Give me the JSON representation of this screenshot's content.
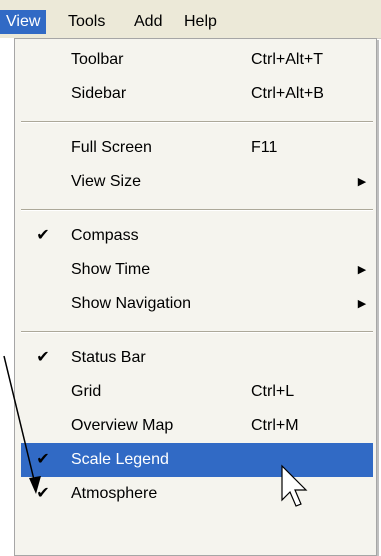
{
  "menubar": {
    "items": [
      "View",
      "Tools",
      "Add",
      "Help"
    ],
    "active": "View"
  },
  "menu": {
    "items": [
      {
        "label": "Toolbar",
        "shortcut": "Ctrl+Alt+T",
        "checked": false,
        "submenu": false
      },
      {
        "label": "Sidebar",
        "shortcut": "Ctrl+Alt+B",
        "checked": false,
        "submenu": false
      },
      {
        "label": "Full Screen",
        "shortcut": "F11",
        "checked": false,
        "submenu": false
      },
      {
        "label": "View Size",
        "shortcut": "",
        "checked": false,
        "submenu": true
      },
      {
        "label": "Compass",
        "shortcut": "",
        "checked": true,
        "submenu": false
      },
      {
        "label": "Show Time",
        "shortcut": "",
        "checked": false,
        "submenu": true
      },
      {
        "label": "Show Navigation",
        "shortcut": "",
        "checked": false,
        "submenu": true
      },
      {
        "label": "Status Bar",
        "shortcut": "",
        "checked": true,
        "submenu": false
      },
      {
        "label": "Grid",
        "shortcut": "Ctrl+L",
        "checked": false,
        "submenu": false
      },
      {
        "label": "Overview Map",
        "shortcut": "Ctrl+M",
        "checked": false,
        "submenu": false
      },
      {
        "label": "Scale Legend",
        "shortcut": "",
        "checked": true,
        "submenu": false,
        "highlighted": true
      },
      {
        "label": "Atmosphere",
        "shortcut": "",
        "checked": true,
        "submenu": false
      }
    ]
  },
  "colors": {
    "highlight": "#316ac5",
    "menubar_bg": "#ece9d8",
    "menu_bg": "#f5f4ee"
  },
  "icons": {
    "check": "checkmark-icon",
    "submenu": "submenu-arrow-icon",
    "cursor": "mouse-cursor-icon",
    "annotation": "annotation-arrow"
  }
}
